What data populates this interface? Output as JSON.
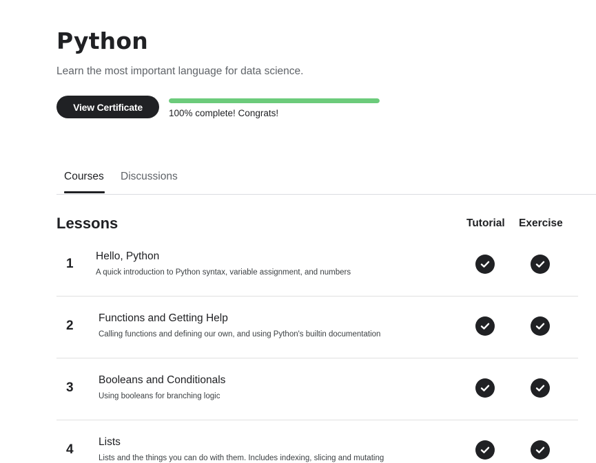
{
  "header": {
    "title": "Python",
    "subtitle": "Learn the most important language for data science."
  },
  "certificate": {
    "button_label": "View Certificate"
  },
  "progress": {
    "percent": 100,
    "text": "100% complete! Congrats!",
    "color": "#6ccb7b"
  },
  "tabs": [
    {
      "label": "Courses",
      "active": true
    },
    {
      "label": "Discussions",
      "active": false
    }
  ],
  "lessons": {
    "heading": "Lessons",
    "columns": {
      "tutorial": "Tutorial",
      "exercise": "Exercise"
    },
    "items": [
      {
        "number": "1",
        "title": "Hello, Python",
        "description": "A quick introduction to Python syntax, variable assignment, and numbers",
        "tutorial_complete": true,
        "exercise_complete": true
      },
      {
        "number": "2",
        "title": "Functions and Getting Help",
        "description": "Calling functions and defining our own, and using Python's builtin documentation",
        "tutorial_complete": true,
        "exercise_complete": true
      },
      {
        "number": "3",
        "title": "Booleans and Conditionals",
        "description": "Using booleans for branching logic",
        "tutorial_complete": true,
        "exercise_complete": true
      },
      {
        "number": "4",
        "title": "Lists",
        "description": "Lists and the things you can do with them. Includes indexing, slicing and mutating",
        "tutorial_complete": true,
        "exercise_complete": true
      }
    ]
  },
  "icons": {
    "complete": "check-circle-icon"
  }
}
